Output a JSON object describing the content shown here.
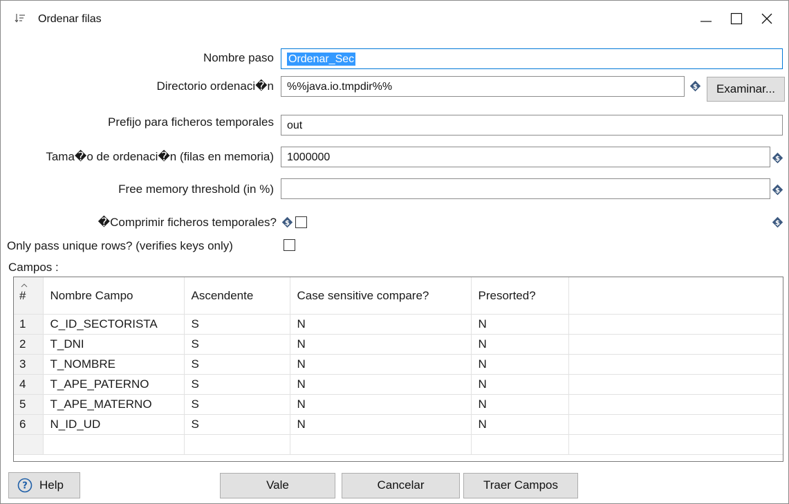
{
  "window": {
    "title": "Ordenar filas",
    "icon": "sort-icon",
    "controls": [
      "minimize-icon",
      "maximize-icon",
      "close-icon"
    ]
  },
  "form": {
    "step_name": {
      "label": "Nombre paso",
      "value": "Ordenar_Sec"
    },
    "sort_directory": {
      "label": "Directorio ordenaci�n",
      "value": "%%java.io.tmpdir%%",
      "browse_label": "Examinar..."
    },
    "temp_prefix": {
      "label": "Prefijo para ficheros temporales",
      "value": "out"
    },
    "sort_size": {
      "label": "Tama�o de ordenaci�n (filas en memoria)",
      "value": "1000000"
    },
    "free_memory": {
      "label": "Free memory threshold (in %)",
      "value": ""
    },
    "compress": {
      "label": "�Comprimir ficheros temporales?",
      "checked": false
    },
    "unique_rows": {
      "label": "Only pass unique rows? (verifies keys only)",
      "checked": false
    }
  },
  "fields": {
    "label": "Campos :",
    "columns": [
      "#",
      "Nombre Campo",
      "Ascendente",
      "Case sensitive compare?",
      "Presorted?"
    ],
    "rows": [
      [
        "1",
        "C_ID_SECTORISTA",
        "S",
        "N",
        "N"
      ],
      [
        "2",
        "T_DNI",
        "S",
        "N",
        "N"
      ],
      [
        "3",
        "T_NOMBRE",
        "S",
        "N",
        "N"
      ],
      [
        "4",
        "T_APE_PATERNO",
        "S",
        "N",
        "N"
      ],
      [
        "5",
        "T_APE_MATERNO",
        "S",
        "N",
        "N"
      ],
      [
        "6",
        "N_ID_UD",
        "S",
        "N",
        "N"
      ]
    ]
  },
  "buttons": {
    "help": "Help",
    "ok": "Vale",
    "cancel": "Cancelar",
    "get_fields": "Traer Campos"
  },
  "colors": {
    "variable_icon": "#3d5a80",
    "focus_border": "#0078d7",
    "selection": "#3399ff",
    "help_icon": "#1f5fa8"
  }
}
